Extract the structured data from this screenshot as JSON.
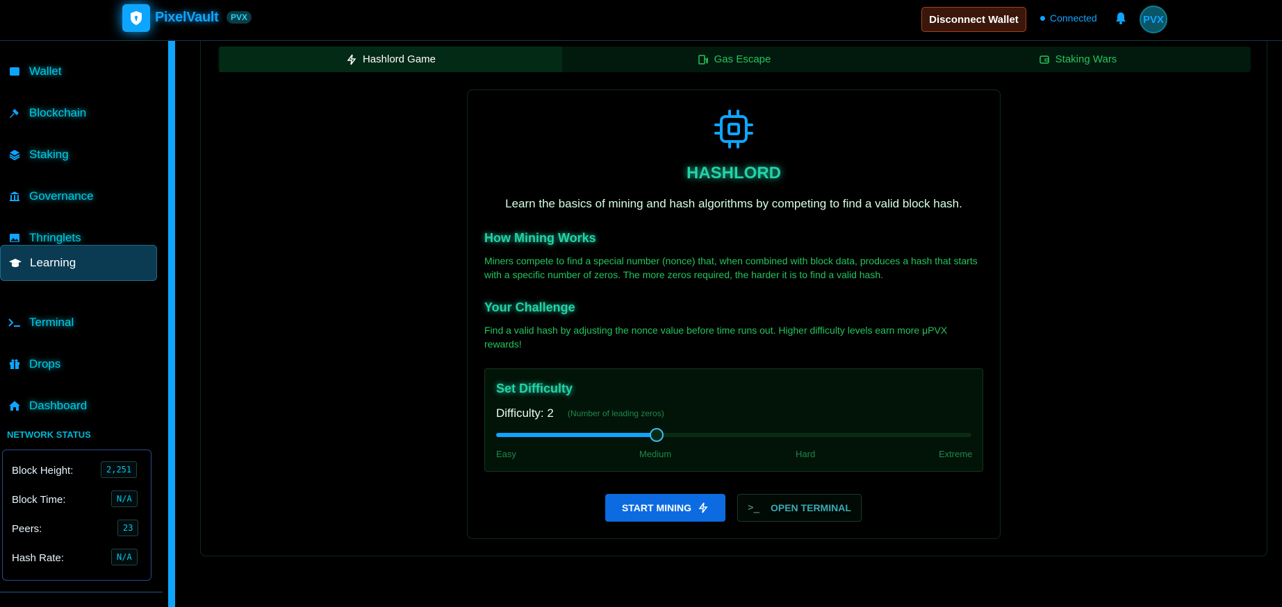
{
  "header": {
    "brand": "PixelVault",
    "badge": "PVX",
    "disconnect_label": "Disconnect  Wallet",
    "status": "Connected",
    "avatar": "PVX",
    "logo_icon": "shield-icon"
  },
  "sidebar": {
    "items": [
      {
        "label": "Wallet",
        "icon": "wallet-icon"
      },
      {
        "label": "Blockchain",
        "icon": "hammer-icon"
      },
      {
        "label": "Staking",
        "icon": "layers-icon"
      },
      {
        "label": "Governance",
        "icon": "bank-icon"
      },
      {
        "label": "Thringlets",
        "icon": "image-icon"
      },
      {
        "label": "Learning",
        "icon": "graduation-cap-icon",
        "active": true
      },
      {
        "label": "Terminal",
        "icon": "terminal-icon"
      },
      {
        "label": "Drops",
        "icon": "gift-icon"
      },
      {
        "label": "Dashboard",
        "icon": "home-icon"
      }
    ],
    "network_status": {
      "title": "NETWORK STATUS",
      "rows": [
        {
          "label": "Block Height:",
          "value": "2,251"
        },
        {
          "label": "Block Time:",
          "value": "N/A"
        },
        {
          "label": "Peers:",
          "value": "23"
        },
        {
          "label": "Hash Rate:",
          "value": "N/A"
        }
      ]
    }
  },
  "tabs": [
    {
      "label": "Hashlord Game",
      "icon": "zap-icon",
      "active": true
    },
    {
      "label": "Gas Escape",
      "icon": "fuel-icon"
    },
    {
      "label": "Staking Wars",
      "icon": "wallet-icon"
    }
  ],
  "game": {
    "icon": "cpu-icon",
    "title": "HASHLORD",
    "description": "Learn the basics of mining and hash algorithms by competing to find a valid block hash.",
    "how_title": "How Mining Works",
    "how_text": "Miners compete to find a special number (nonce) that, when combined with block data, produces a hash that starts with a specific number of zeros. The more zeros required, the harder it is to find a valid hash.",
    "challenge_title": "Your Challenge",
    "challenge_text": "Find a valid hash by adjusting the nonce value before time runs out. Higher difficulty levels earn more μPVX rewards!",
    "difficulty": {
      "title": "Set Difficulty",
      "label": "Difficulty: 2",
      "note": "(Number of leading zeros)",
      "value": 2,
      "level_fraction": 0.337,
      "ticks": [
        "Easy",
        "Medium",
        "Hard",
        "Extreme"
      ]
    },
    "start_label": "START MINING",
    "terminal_label": "OPEN TERMINAL",
    "terminal_prefix": ">_"
  },
  "colors": {
    "accent": "#0ea5ff",
    "neon_green": "#22c55e",
    "teal": "#22d3a8"
  }
}
